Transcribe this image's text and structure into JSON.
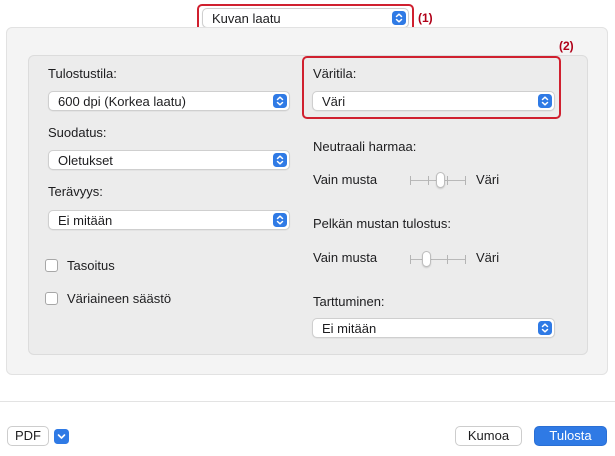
{
  "top_select": {
    "value": "Kuvan laatu"
  },
  "callouts": {
    "one": "(1)",
    "two": "(2)"
  },
  "left": {
    "print_mode_label": "Tulostustila:",
    "print_mode_value": "600 dpi (Korkea laatu)",
    "filter_label": "Suodatus:",
    "filter_value": "Oletukset",
    "sharpness_label": "Terävyys:",
    "sharpness_value": "Ei mitään",
    "smoothing_label": "Tasoitus",
    "toner_save_label": "Väriaineen säästö"
  },
  "right": {
    "color_mode_label": "Väritila:",
    "color_mode_value": "Väri",
    "neutral_gray_label": "Neutraali harmaa:",
    "neutral_gray_left": "Vain musta",
    "neutral_gray_right": "Väri",
    "neutral_gray_level": 0.55,
    "pure_black_label": "Pelkän mustan tulostus:",
    "pure_black_left": "Vain musta",
    "pure_black_right": "Väri",
    "pure_black_level": 0.3,
    "trapping_label": "Tarttuminen:",
    "trapping_value": "Ei mitään"
  },
  "footer": {
    "pdf_label": "PDF",
    "cancel_label": "Kumoa",
    "print_label": "Tulosta"
  },
  "colors": {
    "accent": "#2f7ae5",
    "highlight": "#d0202f"
  },
  "icons": {
    "select_chevron": "chevron-updown-icon",
    "pdf_menu": "chevron-down-icon"
  }
}
